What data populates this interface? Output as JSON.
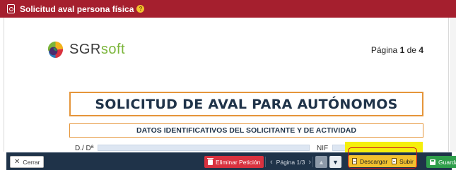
{
  "window": {
    "title": "Solicitud aval persona física"
  },
  "document": {
    "logo": {
      "brand_prefix": "SGR",
      "brand_suffix": "soft"
    },
    "page_indicator": {
      "prefix": "Página",
      "current": "1",
      "separator": "de",
      "total": "4"
    },
    "main_title": "SOLICITUD DE AVAL PARA AUTÓNOMOS",
    "section_title": "DATOS IDENTIFICATIVOS DEL SOLICITANTE Y DE ACTIVIDAD",
    "fields": {
      "name_label": "D./ Dª",
      "nif_label": "NIF"
    }
  },
  "toolbar": {
    "close_label": "Cerrar",
    "delete_label": "Eliminar Petición",
    "pager_label": "Página 1/3",
    "download_label": "Descargar",
    "upload_label": "Subir",
    "save_label": "Guardar"
  },
  "colors": {
    "titlebar": "#a51f2e",
    "toolbar": "#1f3349",
    "accent_orange": "#e5953a",
    "delete": "#d9323f",
    "save": "#2f9e4b",
    "download_upload": "#f2c12e",
    "highlight": "#f5ef0c"
  },
  "icons": [
    "document-icon",
    "help-icon",
    "sgrsoft-logo",
    "close-icon",
    "trash-icon",
    "chevron-left-icon",
    "chevron-right-icon",
    "arrow-up-icon",
    "arrow-down-icon",
    "file-icon",
    "save-icon"
  ]
}
